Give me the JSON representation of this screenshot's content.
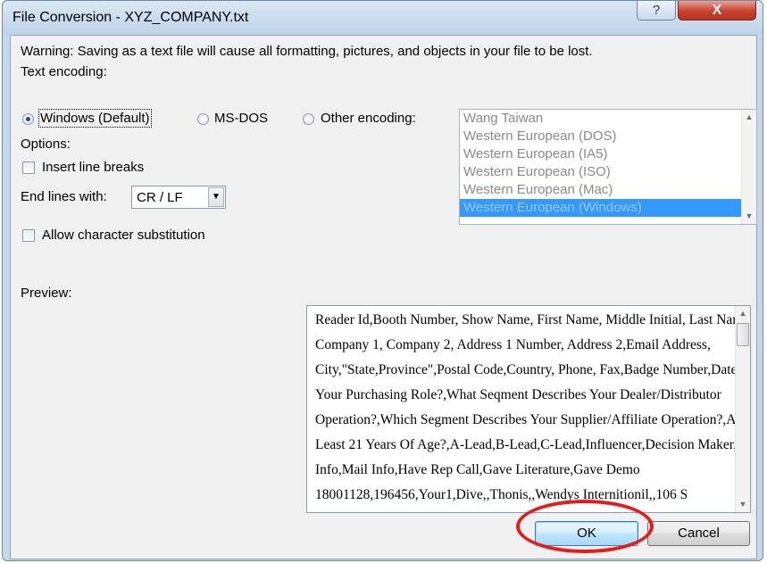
{
  "window": {
    "title": "File Conversion - XYZ_COMPANY.txt",
    "help_glyph": "?",
    "close_glyph": "X"
  },
  "warning": "Warning: Saving as a text file will cause all formatting, pictures, and objects in your file to be lost.",
  "text_encoding": {
    "label": "Text encoding:",
    "options": [
      {
        "label": "Windows (Default)",
        "selected": true
      },
      {
        "label": "MS-DOS",
        "selected": false
      },
      {
        "label": "Other encoding:",
        "selected": false
      }
    ],
    "list": [
      "Wang Taiwan",
      "Western European (DOS)",
      "Western European (IA5)",
      "Western European (ISO)",
      "Western European (Mac)",
      "Western European (Windows)"
    ],
    "list_selected": "Western European (Windows)"
  },
  "options": {
    "label": "Options:",
    "insert_line_breaks": {
      "label": "Insert line breaks",
      "checked": false
    },
    "end_lines_label": "End lines with:",
    "end_lines_value": "CR / LF",
    "allow_substitution": {
      "label": "Allow character substitution",
      "checked": false
    }
  },
  "preview": {
    "label": "Preview:",
    "lines": [
      "Reader Id,Booth Number, Show Name, First Name, Middle Initial, Last Name, Title,",
      "Company 1, Company 2, Address 1 Number, Address 2,Email Address,",
      "City,\"State,Province\",Postal Code,Country, Phone, Fax,Badge Number,Date,Time,What Is",
      "Your Purchasing Role?,What Seqment Describes Your Dealer/Distributor",
      "Operation?,Which Segment Describes Your Supplier/Affiliate Operation?,Are You At",
      "Least 21 Years Of Age?,A-Lead,B-Lead,C-Lead,Influencer,Decision Maker,E-Mail",
      "Info,Mail Info,Have Rep Call,Gave Literature,Gave Demo",
      "18001128,196456,Your1,Dive,,Thonis,,Wendys Internitionil,,106 S"
    ]
  },
  "buttons": {
    "ok": "OK",
    "cancel": "Cancel"
  },
  "colors": {
    "highlight_ring": "#e31c1c",
    "selection": "#3399ff",
    "close_button": "#c8412f"
  }
}
